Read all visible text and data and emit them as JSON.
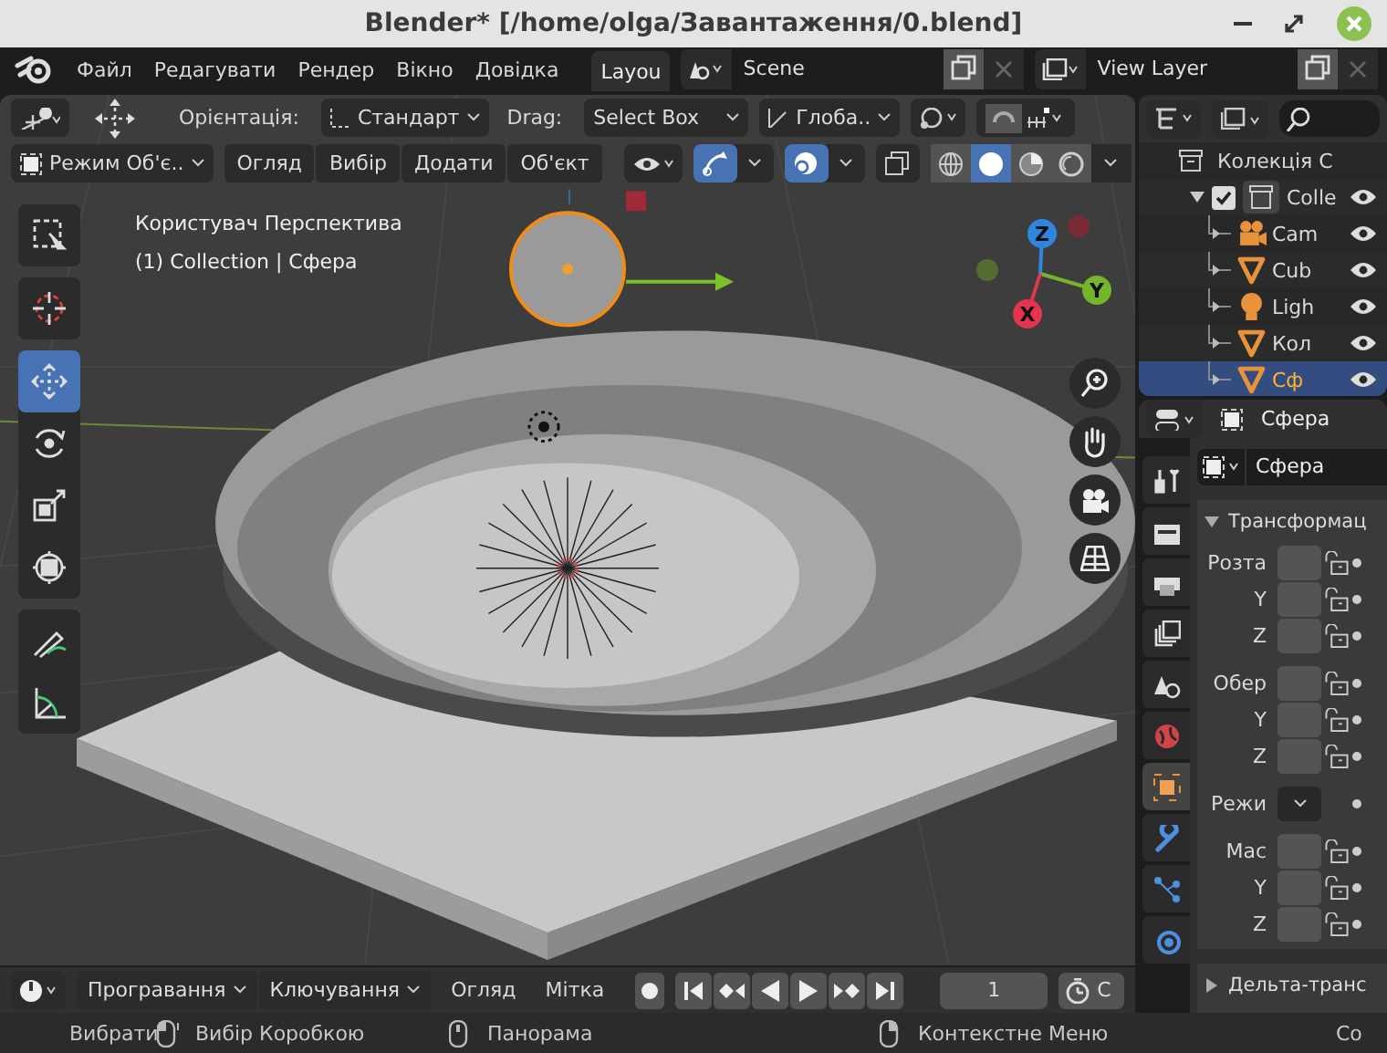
{
  "window": {
    "title": "Blender* [/home/olga/Завантаження/0.blend]"
  },
  "menu": [
    "Файл",
    "Редагувати",
    "Рендер",
    "Вікно",
    "Довідка"
  ],
  "workspace_tabs": [
    {
      "label": "Layou",
      "selected": true
    }
  ],
  "scene": {
    "name": "Scene"
  },
  "view_layer": {
    "name": "View Layer"
  },
  "tool_header": {
    "orientation_label": "Орієнтація:",
    "orientation": "Стандарт",
    "drag_label": "Drag:",
    "drag": "Select Box",
    "transform_orientation": "Глоба.."
  },
  "viewport_header": {
    "mode": "Режим Об'є..",
    "menus": [
      "Огляд",
      "Вибір",
      "Додати",
      "Об'єкт"
    ],
    "toggles": [
      {
        "kind": "gizmo",
        "on": true
      },
      {
        "kind": "overlay",
        "on": true
      },
      {
        "kind": "xray",
        "on": false
      }
    ],
    "shading": [
      {
        "kind": "wireframe",
        "selected": false
      },
      {
        "kind": "solid",
        "selected": true
      },
      {
        "kind": "material",
        "selected": false
      },
      {
        "kind": "rendered",
        "selected": false
      }
    ]
  },
  "viewport": {
    "view_name": "Користувач Перспектива",
    "object_info": "(1) Collection | Сфера",
    "tool_groups": [
      {
        "tools": [
          {
            "kind": "select",
            "selected": false
          }
        ]
      },
      {
        "tools": [
          {
            "kind": "cursor",
            "selected": false
          }
        ]
      },
      {
        "tools": [
          {
            "kind": "move",
            "selected": true
          },
          {
            "kind": "rotate",
            "selected": false
          },
          {
            "kind": "scale",
            "selected": false
          },
          {
            "kind": "transform",
            "selected": false
          }
        ]
      },
      {
        "tools": [
          {
            "kind": "annotate",
            "selected": false
          },
          {
            "kind": "measure",
            "selected": false
          }
        ]
      }
    ],
    "axes": [
      {
        "label": "Z",
        "color": "#2f84e0"
      },
      {
        "label": "Y",
        "color": "#74b52c"
      },
      {
        "label": "X",
        "color": "#e5344d"
      }
    ]
  },
  "outliner": {
    "root": "Колекція С",
    "items": [
      {
        "label": "Colle",
        "checked": true,
        "expanded": true,
        "children": [
          {
            "label": "Cam",
            "kind": "camera",
            "selected": false
          },
          {
            "label": "Cub",
            "kind": "mesh",
            "selected": false
          },
          {
            "label": "Ligh",
            "kind": "light",
            "selected": false
          },
          {
            "label": "Кол",
            "kind": "mesh",
            "selected": false
          },
          {
            "label": "Сф",
            "kind": "mesh",
            "selected": true
          }
        ]
      }
    ]
  },
  "properties": {
    "object_name": "Сфера",
    "name_field": "Сфера",
    "tabs": [
      {
        "kind": "tool",
        "selected": false
      },
      {
        "kind": "render",
        "selected": false
      },
      {
        "kind": "output",
        "selected": false
      },
      {
        "kind": "view_layer",
        "selected": false
      },
      {
        "kind": "scene",
        "selected": false
      },
      {
        "kind": "world",
        "selected": false
      },
      {
        "kind": "object",
        "selected": true
      },
      {
        "kind": "modifier",
        "selected": false
      },
      {
        "kind": "particles",
        "selected": false
      },
      {
        "kind": "physics",
        "selected": false
      }
    ],
    "panels": [
      {
        "title": "Трансформац",
        "expanded": true,
        "rows": [
          {
            "label": "Розта",
            "kind": "field"
          },
          {
            "label": "Y",
            "kind": "field"
          },
          {
            "label": "Z",
            "kind": "field"
          },
          {
            "label": "Обер",
            "kind": "field"
          },
          {
            "label": "Y",
            "kind": "field"
          },
          {
            "label": "Z",
            "kind": "field"
          },
          {
            "label": "Режи",
            "kind": "dropdown"
          },
          {
            "label": "Мас",
            "kind": "field"
          },
          {
            "label": "Y",
            "kind": "field"
          },
          {
            "label": "Z",
            "kind": "field"
          }
        ]
      },
      {
        "title": "Дельта-транс",
        "expanded": false
      }
    ]
  },
  "timeline": {
    "menus": [
      "Програвання",
      "Ключування"
    ],
    "items": [
      "Огляд",
      "Мітка"
    ],
    "frame": "1",
    "start_label": "С"
  },
  "status_bar": [
    {
      "kind": "left",
      "label": "Вибрати"
    },
    {
      "kind": "drag",
      "label": "Вибір Коробкою"
    },
    {
      "kind": "middle",
      "label": "Панорама"
    },
    {
      "kind": "right",
      "label": "Контекстне Меню"
    },
    {
      "kind": "none",
      "label": "Со"
    }
  ]
}
